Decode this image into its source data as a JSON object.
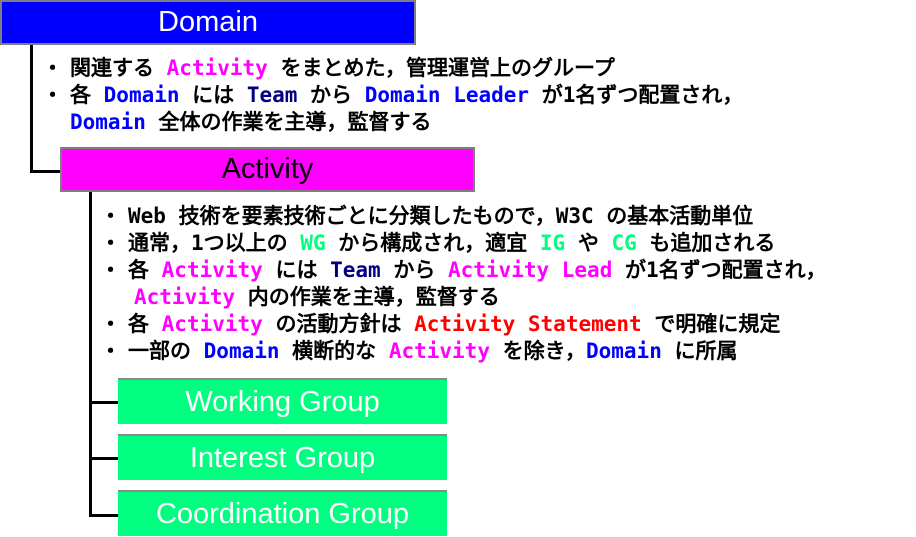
{
  "colors": {
    "domain": "#0000ff",
    "team": "#000080",
    "activity": "#ff00ff",
    "group": "#00ff80",
    "statement": "#ff0000",
    "text": "#000000",
    "box_border": "#7f7f7f",
    "box_label_dark": "#000000",
    "box_label_light": "#ffffff"
  },
  "domain": {
    "label": "Domain",
    "bullet": "・",
    "notes": [
      {
        "segments": [
          {
            "text": "関連する ",
            "color": "text"
          },
          {
            "text": "Activity",
            "color": "activity"
          },
          {
            "text": " をまとめた，管理運営上のグループ",
            "color": "text"
          }
        ]
      },
      {
        "segments": [
          {
            "text": "各 ",
            "color": "text"
          },
          {
            "text": "Domain",
            "color": "domain"
          },
          {
            "text": " には ",
            "color": "text"
          },
          {
            "text": "Team",
            "color": "team"
          },
          {
            "text": " から ",
            "color": "text"
          },
          {
            "text": "Domain Leader",
            "color": "domain"
          },
          {
            "text": " が1名ずつ配置され，",
            "color": "text"
          }
        ]
      },
      {
        "continuation": true,
        "segments": [
          {
            "text": "Domain",
            "color": "domain"
          },
          {
            "text": " 全体の作業を主導，監督する",
            "color": "text"
          }
        ]
      }
    ]
  },
  "activity": {
    "label": "Activity",
    "bullet": "・",
    "notes": [
      {
        "segments": [
          {
            "text": "Web 技術を要素技術ごとに分類したもので，W3C の基本活動単位",
            "color": "text"
          }
        ]
      },
      {
        "segments": [
          {
            "text": "通常，1つ以上の ",
            "color": "text"
          },
          {
            "text": "WG",
            "color": "group"
          },
          {
            "text": " から構成され，適宜 ",
            "color": "text"
          },
          {
            "text": "IG",
            "color": "group"
          },
          {
            "text": " や ",
            "color": "text"
          },
          {
            "text": "CG",
            "color": "group"
          },
          {
            "text": " も追加される",
            "color": "text"
          }
        ]
      },
      {
        "segments": [
          {
            "text": "各 ",
            "color": "text"
          },
          {
            "text": "Activity",
            "color": "activity"
          },
          {
            "text": " には ",
            "color": "text"
          },
          {
            "text": "Team",
            "color": "team"
          },
          {
            "text": " から ",
            "color": "text"
          },
          {
            "text": "Activity Lead",
            "color": "activity"
          },
          {
            "text": " が1名ずつ配置され，",
            "color": "text"
          }
        ]
      },
      {
        "continuation": true,
        "segments": [
          {
            "text": "Activity",
            "color": "activity"
          },
          {
            "text": " 内の作業を主導，監督する",
            "color": "text"
          }
        ]
      },
      {
        "segments": [
          {
            "text": "各 ",
            "color": "text"
          },
          {
            "text": "Activity",
            "color": "activity"
          },
          {
            "text": " の活動方針は ",
            "color": "text"
          },
          {
            "text": "Activity Statement",
            "color": "statement"
          },
          {
            "text": " で明確に規定",
            "color": "text"
          }
        ]
      },
      {
        "segments": [
          {
            "text": "一部の ",
            "color": "text"
          },
          {
            "text": "Domain",
            "color": "domain"
          },
          {
            "text": " 横断的な ",
            "color": "text"
          },
          {
            "text": "Activity",
            "color": "activity"
          },
          {
            "text": " を除き，",
            "color": "text"
          },
          {
            "text": "Domain",
            "color": "domain"
          },
          {
            "text": " に所属",
            "color": "text"
          }
        ]
      }
    ]
  },
  "groups": [
    {
      "label": "Working Group"
    },
    {
      "label": "Interest Group"
    },
    {
      "label": "Coordination Group"
    }
  ]
}
